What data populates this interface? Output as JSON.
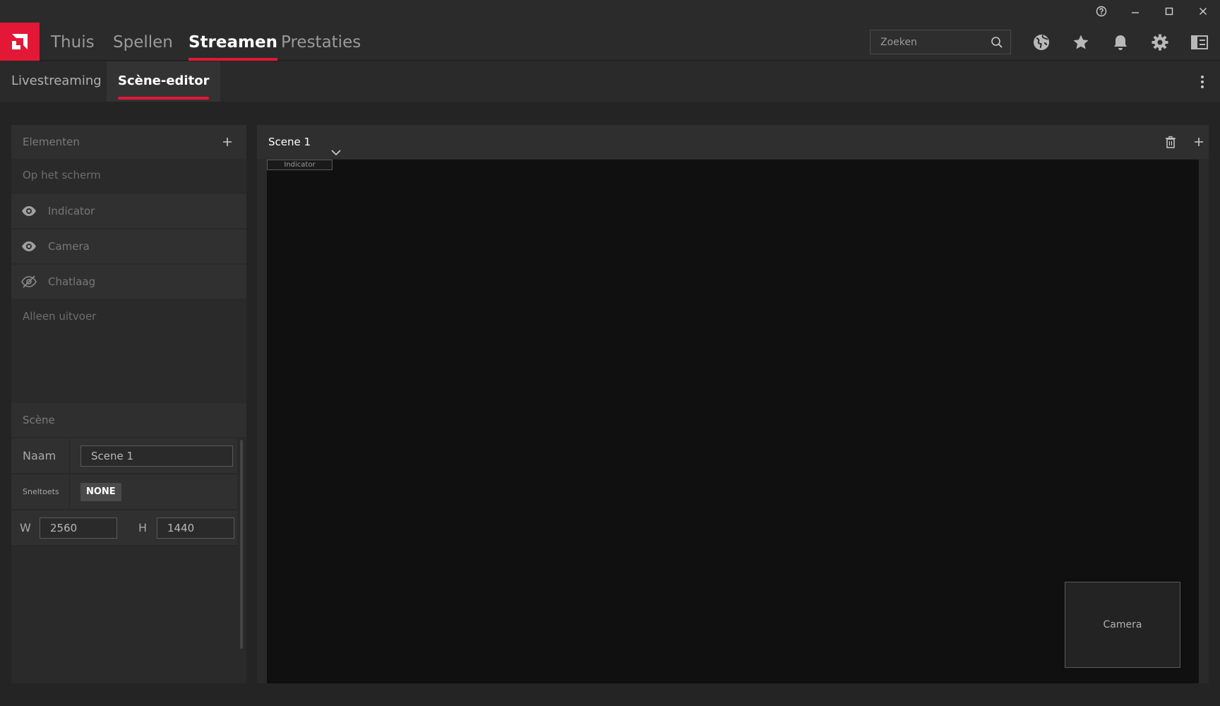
{
  "window": {
    "help_icon": "help-circle-icon",
    "minimize_icon": "minimize-icon",
    "maximize_icon": "maximize-icon",
    "close_icon": "close-icon"
  },
  "nav": {
    "logo": "amd-logo",
    "tabs": [
      {
        "label": "Thuis"
      },
      {
        "label": "Spellen"
      },
      {
        "label": "Streamen"
      },
      {
        "label": "Prestaties"
      }
    ],
    "active_tab": "Streamen",
    "search": {
      "placeholder": "Zoeken",
      "value": ""
    },
    "icons": [
      "globe-icon",
      "star-icon",
      "bell-icon",
      "gear-icon",
      "sidebar-layout-icon"
    ]
  },
  "subnav": {
    "tabs": [
      {
        "label": "Livestreaming"
      },
      {
        "label": "Scène-editor"
      }
    ],
    "active_tab": "Scène-editor",
    "more_icon": "more-vertical-icon"
  },
  "elements_panel": {
    "title": "Elementen",
    "on_screen_label": "Op het scherm",
    "items": [
      {
        "name": "Indicator",
        "visible": true,
        "icon": "eye-icon"
      },
      {
        "name": "Camera",
        "visible": true,
        "icon": "eye-icon"
      },
      {
        "name": "Chatlaag",
        "visible": false,
        "icon": "eye-off-icon"
      }
    ],
    "output_only_label": "Alleen uitvoer"
  },
  "scene_panel": {
    "title": "Scène",
    "name_label": "Naam",
    "name_value": "Scene 1",
    "hotkey_label": "Sneltoets",
    "hotkey_value": "NONE",
    "width_label": "W",
    "width_value": "2560",
    "height_label": "H",
    "height_value": "1440"
  },
  "canvas": {
    "scene_selected": "Scene 1",
    "indicator_label": "Indicator",
    "camera_label": "Camera"
  },
  "colors": {
    "accent": "#e21836",
    "background": "#242424",
    "panel": "#2a2a2a",
    "canvas": "#101010"
  }
}
